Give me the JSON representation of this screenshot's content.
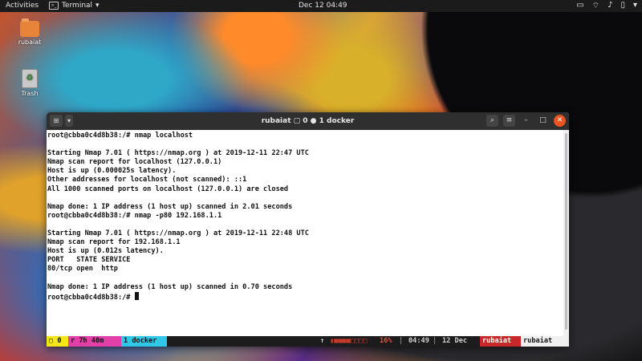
{
  "topbar": {
    "activities": "Activities",
    "app_name": "Terminal",
    "clock": "Dec 12  04:49",
    "tray_icons": [
      "screen-icon",
      "wifi-icon",
      "volume-icon",
      "battery-icon",
      "chevron-down-icon"
    ]
  },
  "desktop": {
    "home_label": "rubaiat",
    "trash_label": "Trash"
  },
  "window": {
    "title": "rubaiat ▢ 0 ● 1 docker",
    "close_color": "#e95420"
  },
  "terminal": {
    "lines": [
      "root@cbba0c4d8b38:/# nmap localhost",
      "",
      "Starting Nmap 7.01 ( https://nmap.org ) at 2019-12-11 22:47 UTC",
      "Nmap scan report for localhost (127.0.0.1)",
      "Host is up (0.000025s latency).",
      "Other addresses for localhost (not scanned): ::1",
      "All 1000 scanned ports on localhost (127.0.0.1) are closed",
      "",
      "Nmap done: 1 IP address (1 host up) scanned in 2.01 seconds",
      "root@cbba0c4d8b38:/# nmap -p80 192.168.1.1",
      "",
      "Starting Nmap 7.01 ( https://nmap.org ) at 2019-12-11 22:48 UTC",
      "Nmap scan report for 192.168.1.1",
      "Host is up (0.012s latency).",
      "PORT   STATE SERVICE",
      "80/tcp open  http",
      "",
      "Nmap done: 1 IP address (1 host up) scanned in 0.70 seconds"
    ],
    "prompt": "root@cbba0c4d8b38:/# "
  },
  "status_bar": {
    "session": "▢ 0",
    "uptime": "r 7h 40m",
    "window": "1 docker",
    "load_arrow": "↑",
    "cpu": "16%",
    "time": "04:49",
    "date": "12 Dec",
    "user": "rubaiat",
    "host": "rubaiat",
    "colors": {
      "session": "#f5e61a",
      "uptime": "#e040a8",
      "window": "#30c8e8",
      "user": "#c8282a",
      "host": "#f0f0f0"
    }
  }
}
